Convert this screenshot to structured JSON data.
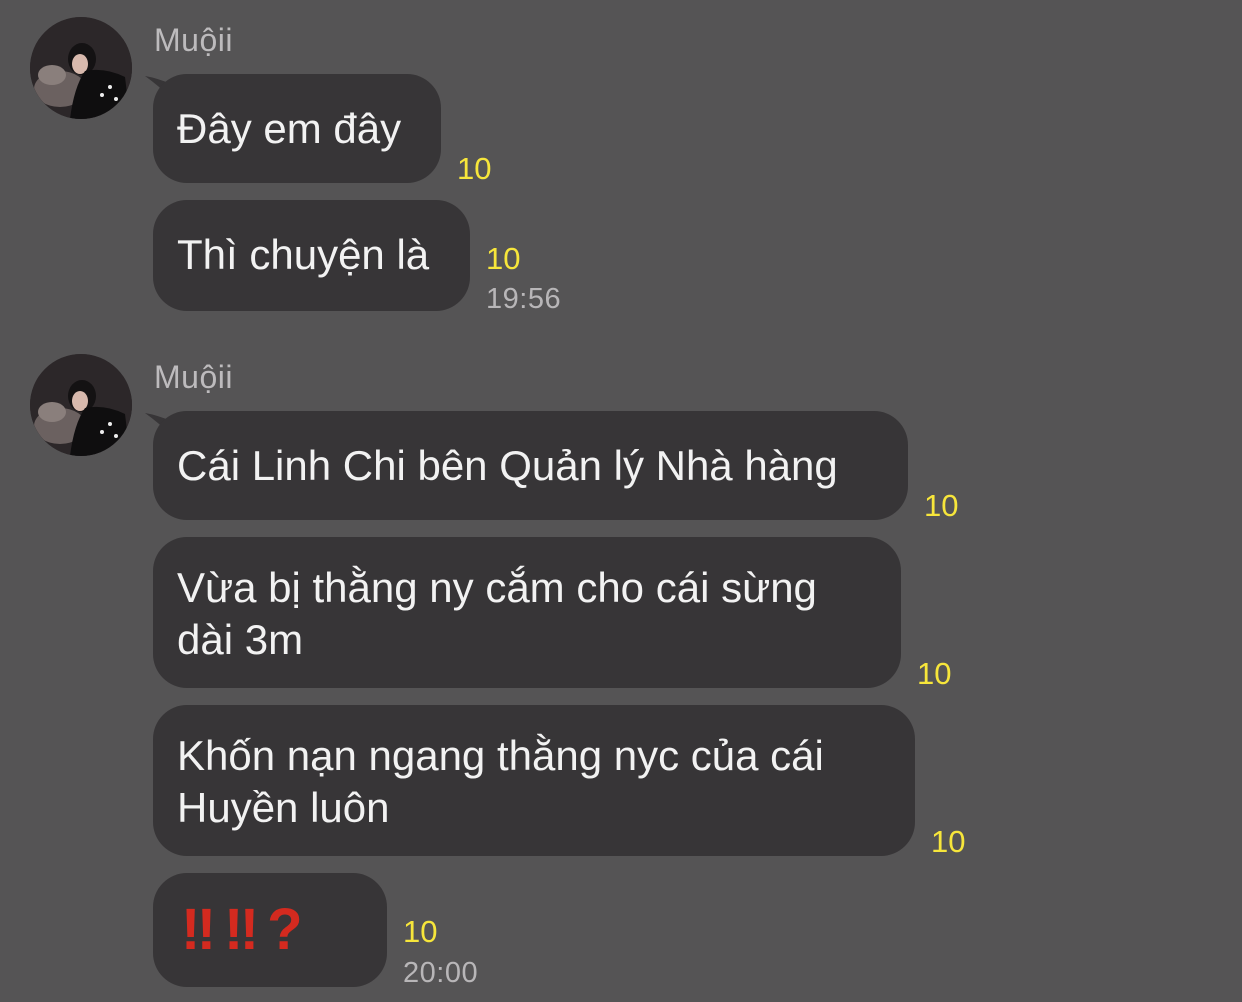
{
  "groups": [
    {
      "sender": "Muộii",
      "messages": [
        {
          "text": "Đây em đây",
          "count": "10"
        },
        {
          "text": "Thì chuyện là",
          "count": "10",
          "time": "19:56"
        }
      ]
    },
    {
      "sender": "Muộii",
      "messages": [
        {
          "text": "Cái Linh Chi bên Quản lý Nhà hàng",
          "count": "10"
        },
        {
          "text": "Vừa bị thằng ny cắm cho cái sừng dài 3m",
          "count": "10"
        },
        {
          "text": "Khốn nạn ngang thằng nyc của cái Huyền luôn",
          "count": "10"
        },
        {
          "emojis": [
            "‼",
            "‼",
            "?"
          ],
          "count": "10",
          "time": "20:00"
        }
      ]
    }
  ],
  "colors": {
    "background": "#555455",
    "bubble": "#373537",
    "count": "#f7e63b",
    "emoji": "#d42a1f"
  },
  "icons": [
    "avatar-photo"
  ]
}
